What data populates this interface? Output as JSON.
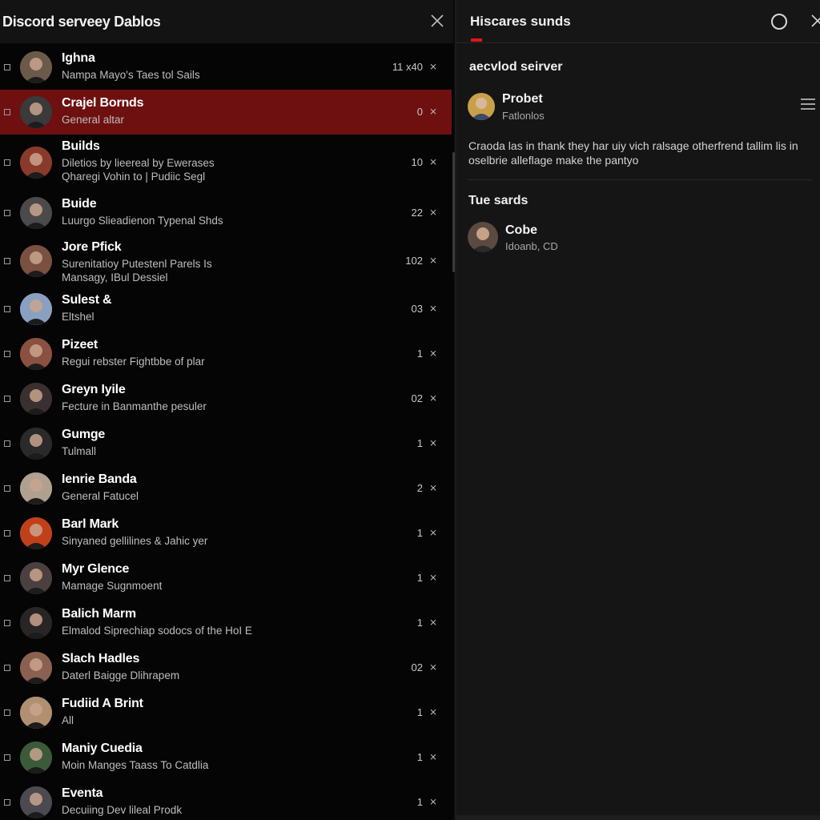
{
  "left_panel": {
    "title": "Discord serveey Dablos",
    "rows": [
      {
        "title": "Ighna",
        "subtitle": "Nampa Mayo's Taes tol Sails",
        "count": "11 x40",
        "avatar_color": "#6b5a4a"
      },
      {
        "title": "Crajel Bornds",
        "subtitle": "General altar",
        "count": "0",
        "avatar_color": "#3a3a3a",
        "selected": true
      },
      {
        "title": "Builds",
        "subtitle": "Diletios by lieereal by Ewerases\nQharegi Vohin to | Pudiic Segl",
        "count": "10",
        "avatar_color": "#8a3a2a"
      },
      {
        "title": "Buide",
        "subtitle": "Luurgo Slieadienon Typenal Shds",
        "count": "22",
        "avatar_color": "#4a4a4a"
      },
      {
        "title": "Jore Pfick",
        "subtitle": "Surenitatioy Putestenl Parels Is\nMansagy, IBul Dessiel",
        "count": "102",
        "avatar_color": "#7a5040"
      },
      {
        "title": "Sulest &",
        "subtitle": "Eltshel",
        "count": "03",
        "avatar_color": "#8aa0c0"
      },
      {
        "title": "Pizeet",
        "subtitle": "Regui rebster Fightbbe of plar",
        "count": "1",
        "avatar_color": "#8a5040"
      },
      {
        "title": "Greyn Iyile",
        "subtitle": "Fecture in Banmanthe pesuler",
        "count": "02",
        "avatar_color": "#3a3030"
      },
      {
        "title": "Gumge",
        "subtitle": "Tulmall",
        "count": "1",
        "avatar_color": "#2a2a2a"
      },
      {
        "title": "Ienrie Banda",
        "subtitle": "General Fatucel",
        "count": "2",
        "avatar_color": "#b0a090"
      },
      {
        "title": "Barl Mark",
        "subtitle": "Sinyaned gellilines & Jahic yer",
        "count": "1",
        "avatar_color": "#c0401a"
      },
      {
        "title": "Myr Glence",
        "subtitle": "Mamage Sugnmoent",
        "count": "1",
        "avatar_color": "#4a4040"
      },
      {
        "title": "Balich Marm",
        "subtitle": "Elmalod Siprechiap sodocs of the HoI E",
        "count": "1",
        "avatar_color": "#2a2525"
      },
      {
        "title": "Slach Hadles",
        "subtitle": "Daterl Baigge Dlihrapem",
        "count": "02",
        "avatar_color": "#8a6050"
      },
      {
        "title": "Fudiid A Brint",
        "subtitle": "All",
        "count": "1",
        "avatar_color": "#b09070"
      },
      {
        "title": "Maniy Cuedia",
        "subtitle": "Moin Manges Taass To Catdlia",
        "count": "1",
        "avatar_color": "#3a5a3a"
      },
      {
        "title": "Eventa",
        "subtitle": "Decuiing Dev lileal Prodk",
        "count": "1",
        "avatar_color": "#4a4a50"
      }
    ]
  },
  "right_panel": {
    "title": "Hiscares sunds",
    "section_heading": "aecvlod seirver",
    "poster": {
      "name": "Probet",
      "subtitle": "Fatlonlos"
    },
    "message": "Craoda las in thank they har uiy vich ralsage otherfrend tallim lis in oselbrie alleflage make the pantyo",
    "section2_heading": "Tue sards",
    "member": {
      "name": "Cobe",
      "subtitle": "Idoanb, CD"
    }
  },
  "colors": {
    "accent": "#e01818",
    "selected_row": "#6e1010",
    "background": "#050505",
    "panel": "#151515"
  },
  "icons": {
    "left_close": "close-icon",
    "right_status": "circle-icon",
    "right_close": "close-icon",
    "menu": "hamburger-menu-icon",
    "row_pin": "pin-icon",
    "row_checkbox": "checkbox-icon"
  }
}
